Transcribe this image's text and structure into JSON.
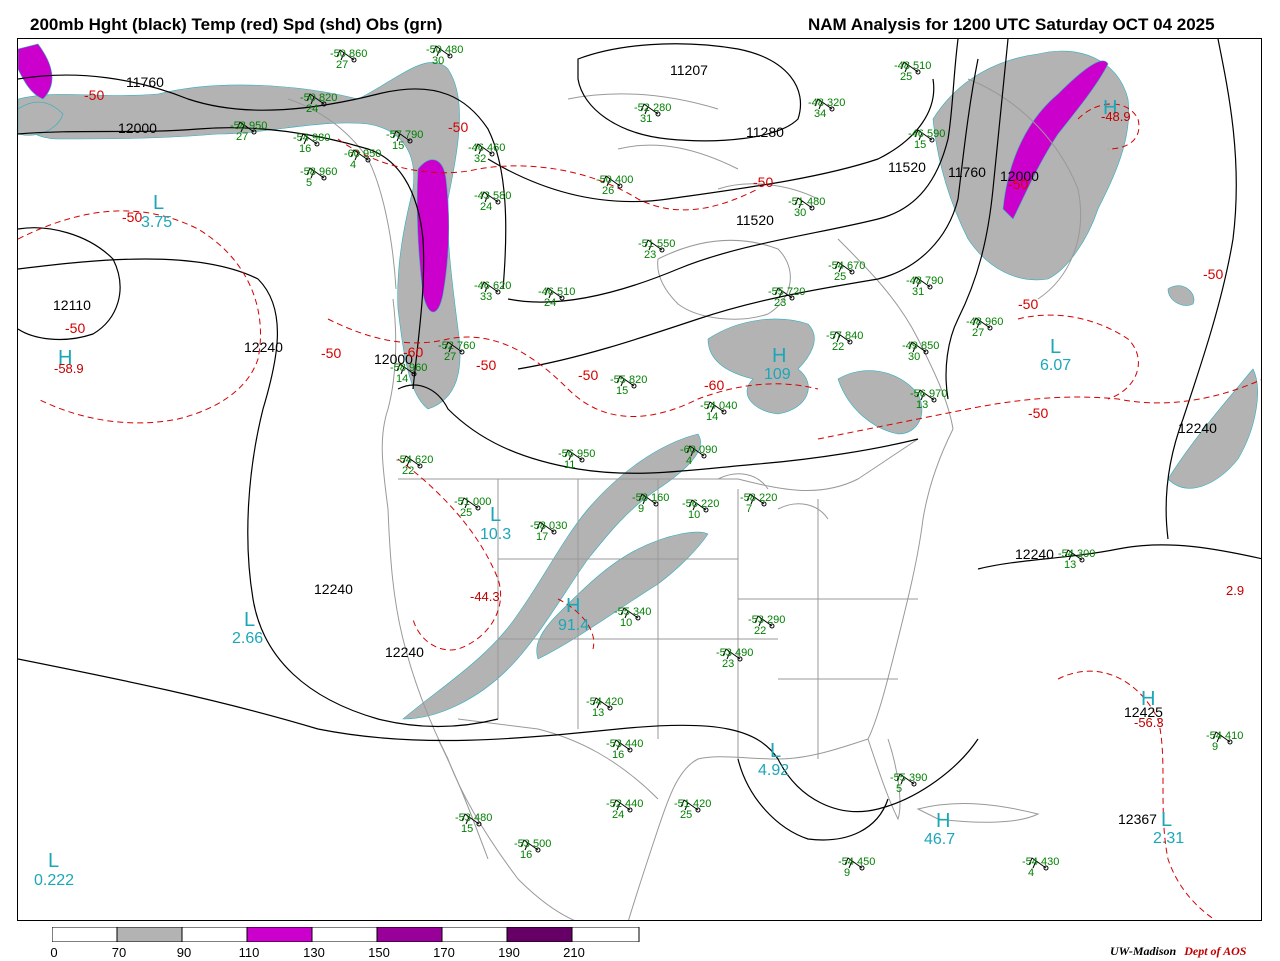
{
  "header": {
    "title_left": "200mb Hght (black) Temp (red) Spd (shd) Obs (grn)",
    "title_right": "NAM Analysis for 1200 UTC Saturday  OCT 04 2025"
  },
  "colors": {
    "height_contour": "#000000",
    "temperature_contour": "#d40000",
    "speed_70_90": "#b3b3b3",
    "speed_110_130": "#cc00cc",
    "speed_150_170": "#990099",
    "speed_190_210": "#660066",
    "observations": "#008000",
    "extrema": "#1ba7b8",
    "map_lines": "#999999"
  },
  "scale": {
    "labels": [
      "0",
      "70",
      "90",
      "110",
      "130",
      "150",
      "170",
      "190",
      "210"
    ]
  },
  "height_labels": [
    "11760",
    "12000",
    "11207",
    "11280",
    "11520",
    "11760",
    "12000",
    "11520",
    "12110",
    "12240",
    "12000",
    "12240",
    "12240",
    "12240",
    "12240",
    "12425",
    "12367"
  ],
  "temp_labels": [
    "-50",
    "-50",
    "-50",
    "-50",
    "-50",
    "-50",
    "-50",
    "-60",
    "-50",
    "-60",
    "-50",
    "-50",
    "-50",
    "-50"
  ],
  "extrema": [
    {
      "type": "L",
      "value": "3.75"
    },
    {
      "type": "H",
      "value": "-58.9"
    },
    {
      "type": "L",
      "value": "10.3"
    },
    {
      "type": "H",
      "value": "91.4"
    },
    {
      "type": "L",
      "value": "2.66"
    },
    {
      "type": "H",
      "value": "109"
    },
    {
      "type": "L",
      "value": "6.07"
    },
    {
      "type": "L",
      "value": "4.92"
    },
    {
      "type": "H",
      "value": "46.7"
    },
    {
      "type": "L",
      "value": "2.31"
    },
    {
      "type": "L",
      "value": "0.222"
    },
    {
      "type": "H",
      "value": "12425"
    },
    {
      "type": "H",
      "value": "-48.9"
    },
    {
      "type": "L",
      "value": "2.9"
    },
    {
      "type": "H",
      "value": "-44.3"
    },
    {
      "type": "H",
      "value": "-56.3"
    }
  ],
  "observations": [
    {
      "t": "-50",
      "h": "860",
      "s": "27"
    },
    {
      "t": "-50",
      "h": "480",
      "s": "30"
    },
    {
      "t": "-50",
      "h": "820",
      "s": "24"
    },
    {
      "t": "-58",
      "h": "950",
      "s": "27"
    },
    {
      "t": "-54",
      "h": "980",
      "s": "16"
    },
    {
      "t": "-58",
      "h": "960",
      "s": "5"
    },
    {
      "t": "-60",
      "h": "950",
      "s": "4"
    },
    {
      "t": "-57",
      "h": "790",
      "s": "15"
    },
    {
      "t": "-46",
      "h": "460",
      "s": "32"
    },
    {
      "t": "-43",
      "h": "580",
      "s": "24"
    },
    {
      "t": "-50",
      "h": "400",
      "s": "26"
    },
    {
      "t": "-52",
      "h": "280",
      "s": "31"
    },
    {
      "t": "-48",
      "h": "510",
      "s": "25"
    },
    {
      "t": "-48",
      "h": "320",
      "s": "34"
    },
    {
      "t": "-46",
      "h": "590",
      "s": "15"
    },
    {
      "t": "-51",
      "h": "480",
      "s": "30"
    },
    {
      "t": "-51",
      "h": "550",
      "s": "23"
    },
    {
      "t": "-46",
      "h": "620",
      "s": "33"
    },
    {
      "t": "-46",
      "h": "510",
      "s": "24"
    },
    {
      "t": "-55",
      "h": "720",
      "s": "23"
    },
    {
      "t": "-54",
      "h": "670",
      "s": "25"
    },
    {
      "t": "-48",
      "h": "790",
      "s": "31"
    },
    {
      "t": "-57",
      "h": "840",
      "s": "22"
    },
    {
      "t": "-49",
      "h": "850",
      "s": "30"
    },
    {
      "t": "-48",
      "h": "960",
      "s": "27"
    },
    {
      "t": "-52",
      "h": "760",
      "s": "27"
    },
    {
      "t": "-58",
      "h": "960",
      "s": "14"
    },
    {
      "t": "-55",
      "h": "820",
      "s": "15"
    },
    {
      "t": "-54",
      "h": "040",
      "s": "14"
    },
    {
      "t": "-56",
      "h": "970",
      "s": "13"
    },
    {
      "t": "-54",
      "h": "620",
      "s": "22"
    },
    {
      "t": "-56",
      "h": "950",
      "s": "11"
    },
    {
      "t": "-60",
      "h": "090",
      "s": "4"
    },
    {
      "t": "-51",
      "h": "000",
      "s": "25"
    },
    {
      "t": "-58",
      "h": "030",
      "s": "17"
    },
    {
      "t": "-58",
      "h": "160",
      "s": "9"
    },
    {
      "t": "-56",
      "h": "220",
      "s": "10"
    },
    {
      "t": "-58",
      "h": "220",
      "s": "7"
    },
    {
      "t": "-54",
      "h": "300",
      "s": "13"
    },
    {
      "t": "-55",
      "h": "340",
      "s": "10"
    },
    {
      "t": "-53",
      "h": "290",
      "s": "22"
    },
    {
      "t": "-53",
      "h": "490",
      "s": "23"
    },
    {
      "t": "-52",
      "h": "440",
      "s": "24"
    },
    {
      "t": "-51",
      "h": "420",
      "s": "25"
    },
    {
      "t": "-53",
      "h": "480",
      "s": "15"
    },
    {
      "t": "-53",
      "h": "500",
      "s": "16"
    },
    {
      "t": "-54",
      "h": "410",
      "s": "9"
    },
    {
      "t": "-54",
      "h": "450",
      "s": "9"
    },
    {
      "t": "-54",
      "h": "430",
      "s": "4"
    },
    {
      "t": "-55",
      "h": "390",
      "s": "5"
    },
    {
      "t": "-53",
      "h": "440",
      "s": "16"
    },
    {
      "t": "-54",
      "h": "420",
      "s": "13"
    }
  ],
  "credit": {
    "institution": "UW-Madison",
    "dept": "Dept of AOS"
  }
}
